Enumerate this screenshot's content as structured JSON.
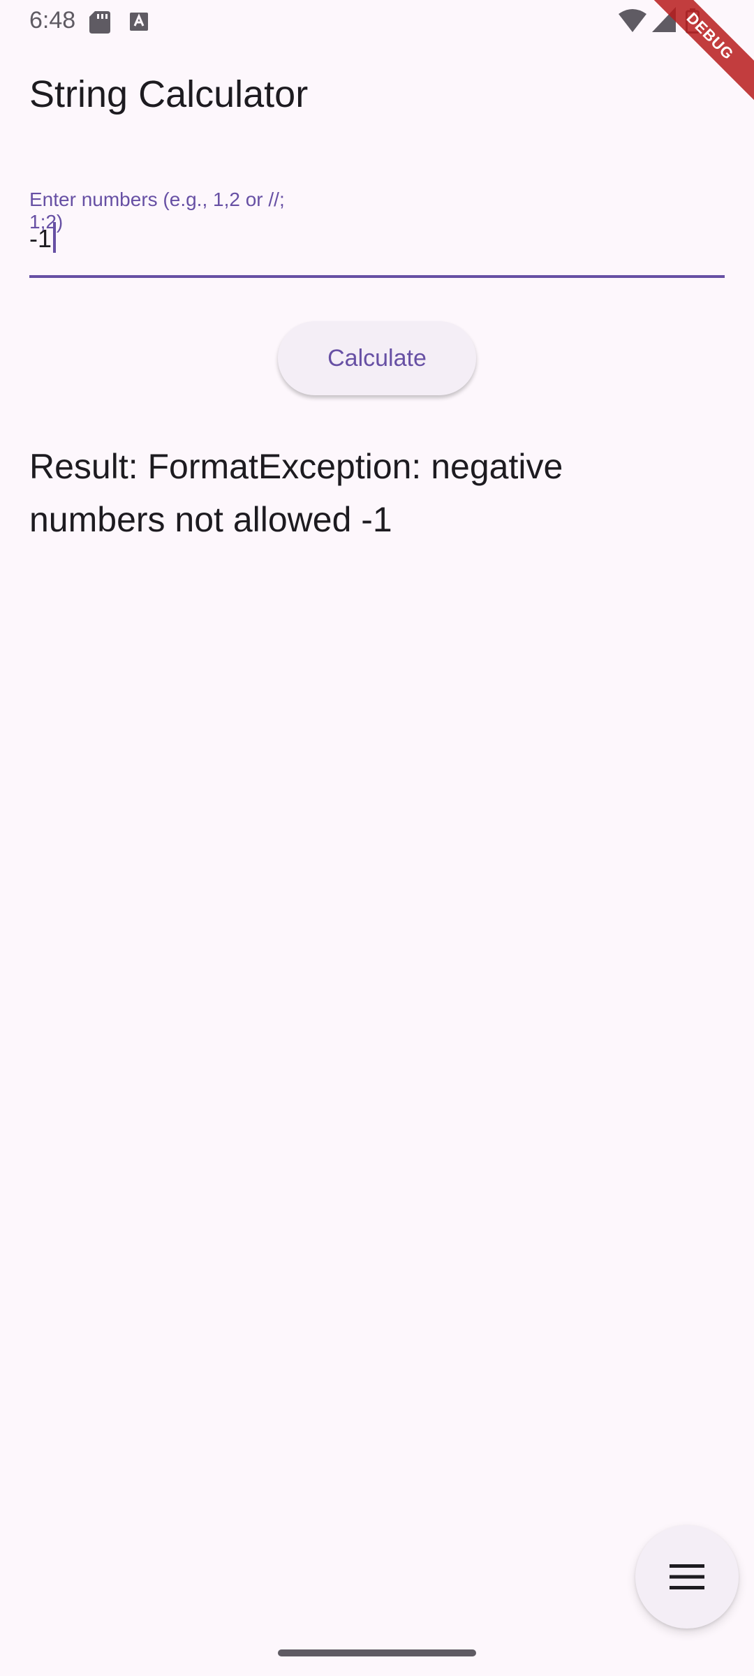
{
  "status_bar": {
    "time": "6:48",
    "icons": [
      "sd-card-icon",
      "text-a-icon",
      "wifi-icon",
      "signal-icon",
      "battery-icon"
    ]
  },
  "debug_banner": "DEBUG",
  "app_bar": {
    "title": "String Calculator"
  },
  "input": {
    "label": "Enter numbers (e.g., 1,2 or //;\n1;2)",
    "value": "-1",
    "focused": true
  },
  "calculate_button": {
    "label": "Calculate"
  },
  "result": {
    "text": "Result: FormatException: negative numbers not allowed -1"
  },
  "fab": {
    "icon": "menu-icon"
  },
  "colors": {
    "background": "#fdf7fc",
    "primary": "#6750a4",
    "surface_container": "#f4eef6",
    "on_surface": "#1d1b20",
    "debug_ribbon": "#b71c1c"
  }
}
